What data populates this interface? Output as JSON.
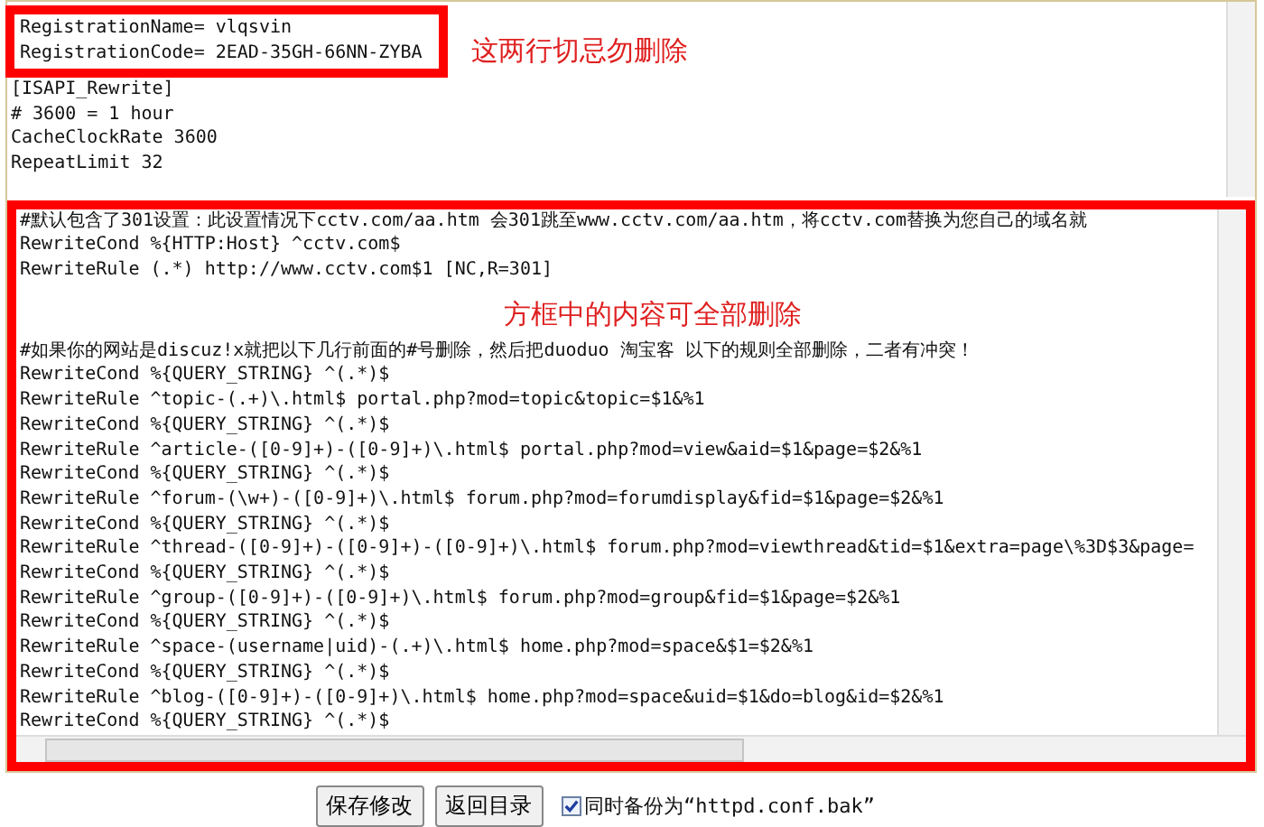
{
  "editor_top": {
    "boxed_lines": [
      "RegistrationName= vlqsvin",
      "RegistrationCode= 2EAD-35GH-66NN-ZYBA"
    ],
    "note": "这两行切忌勿删除",
    "lines": [
      "[ISAPI_Rewrite]",
      "# 3600 = 1 hour",
      "CacheClockRate 3600",
      "RepeatLimit 32"
    ]
  },
  "editor_bottom": {
    "lines_before": [
      "#默认包含了301设置：此设置情况下cctv.com/aa.htm 会301跳至www.cctv.com/aa.htm，将cctv.com替换为您自己的域名就",
      "RewriteCond %{HTTP:Host} ^cctv.com$",
      "RewriteRule (.*) http://www.cctv.com$1 [NC,R=301]"
    ],
    "note": "方框中的内容可全部删除",
    "lines_after": [
      "#如果你的网站是discuz!x就把以下几行前面的#号删除，然后把duoduo 淘宝客 以下的规则全部删除，二者有冲突！",
      "RewriteCond %{QUERY_STRING} ^(.*)$",
      "RewriteRule ^topic-(.+)\\.html$ portal.php?mod=topic&topic=$1&%1",
      "RewriteCond %{QUERY_STRING} ^(.*)$",
      "RewriteRule ^article-([0-9]+)-([0-9]+)\\.html$ portal.php?mod=view&aid=$1&page=$2&%1",
      "RewriteCond %{QUERY_STRING} ^(.*)$",
      "RewriteRule ^forum-(\\w+)-([0-9]+)\\.html$ forum.php?mod=forumdisplay&fid=$1&page=$2&%1",
      "RewriteCond %{QUERY_STRING} ^(.*)$",
      "RewriteRule ^thread-([0-9]+)-([0-9]+)-([0-9]+)\\.html$ forum.php?mod=viewthread&tid=$1&extra=page\\%3D$3&page=",
      "RewriteCond %{QUERY_STRING} ^(.*)$",
      "RewriteRule ^group-([0-9]+)-([0-9]+)\\.html$ forum.php?mod=group&fid=$1&page=$2&%1",
      "RewriteCond %{QUERY_STRING} ^(.*)$",
      "RewriteRule ^space-(username|uid)-(.+)\\.html$ home.php?mod=space&$1=$2&%1",
      "RewriteCond %{QUERY_STRING} ^(.*)$",
      "RewriteRule ^blog-([0-9]+)-([0-9]+)\\.html$ home.php?mod=space&uid=$1&do=blog&id=$2&%1",
      "RewriteCond %{QUERY_STRING} ^(.*)$"
    ]
  },
  "buttons": [
    "保存修改",
    "返回目录"
  ],
  "backup_option": {
    "label": "同时备份为“httpd.conf.bak”",
    "checked": true
  }
}
